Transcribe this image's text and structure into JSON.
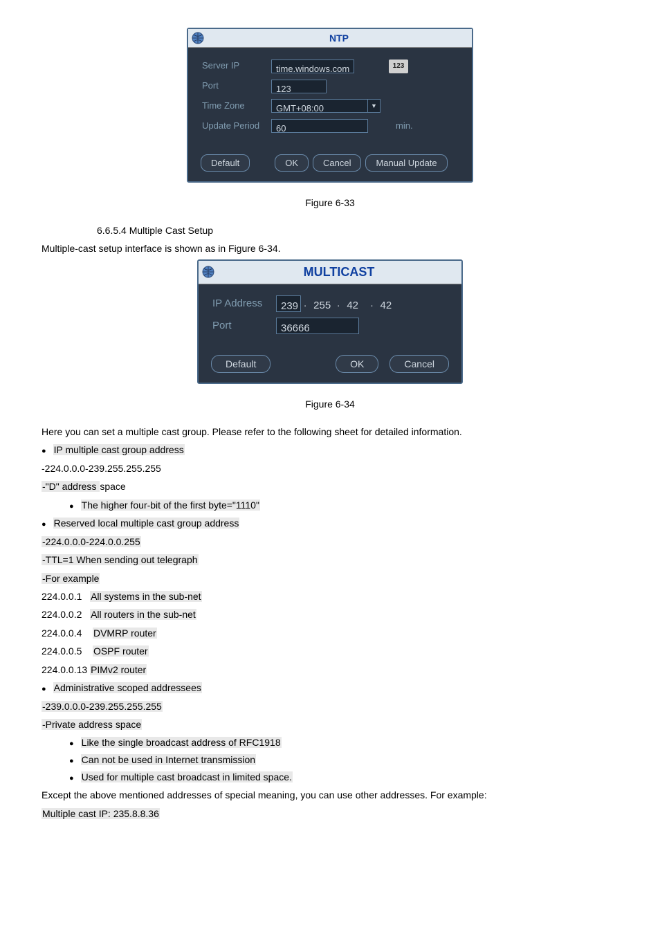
{
  "ntp_dialog": {
    "title": "NTP",
    "server_ip_label": "Server IP",
    "server_ip_value": "time.windows.com",
    "port_label": "Port",
    "port_value": "123",
    "time_zone_label": "Time Zone",
    "time_zone_value": "GMT+08:00",
    "update_period_label": "Update Period",
    "update_period_value": "60",
    "update_period_unit": "min.",
    "kbd_icon_text": "123",
    "btn_default": "Default",
    "btn_ok": "OK",
    "btn_cancel": "Cancel",
    "btn_manual": "Manual Update"
  },
  "figure_633": "Figure 6-33",
  "section_6654": "6.6.5.4 Multiple Cast Setup",
  "intro_6654": "Multiple-cast setup interface is shown as in Figure 6-34.",
  "multicast_dialog": {
    "title": "MULTICAST",
    "ip_label": "IP Address",
    "ip_1": "239",
    "ip_2": "255",
    "ip_3": "42",
    "ip_4": "42",
    "port_label": "Port",
    "port_value": "36666",
    "btn_default": "Default",
    "btn_ok": "OK",
    "btn_cancel": "Cancel"
  },
  "figure_634": "Figure 6-34",
  "body": {
    "intro": "Here you can set a multiple cast group. Please refer to the following sheet for detailed information.",
    "b1": "IP multiple cast group address",
    "l1": "-224.0.0.0-239.255.255.255",
    "l2a": "-\"D\" address ",
    "l2b": "space",
    "b2": "The higher four-bit of the first byte=\"1110\"",
    "b3": "Reserved local multiple cast group address",
    "l3": "-224.0.0.0-224.0.0.255",
    "l4": "-TTL=1 When sending out telegraph",
    "l5": "-For example",
    "r1a": "224.0.0.1",
    "r1b": "All systems in the sub-net",
    "r2a": "224.0.0.2",
    "r2b": "All routers in the sub-net",
    "r3a": "224.0.0.4",
    "r3b": "DVMRP router",
    "r4a": "224.0.0.5",
    "r4b": "OSPF router",
    "r5a": "224.0.0.13 ",
    "r5b": "PIMv2 router",
    "b4": "Administrative scoped addressees",
    "l6": "-239.0.0.0-239.255.255.255",
    "l7": "-Private address space",
    "b5": "Like the single broadcast address of RFC1918",
    "b6": "Can not be used in Internet transmission",
    "b7": "Used for multiple cast broadcast in limited space.",
    "p1": "Except the above mentioned addresses of special meaning, you can use other addresses. For example:",
    "p2": "Multiple cast IP: 235.8.8.36"
  }
}
